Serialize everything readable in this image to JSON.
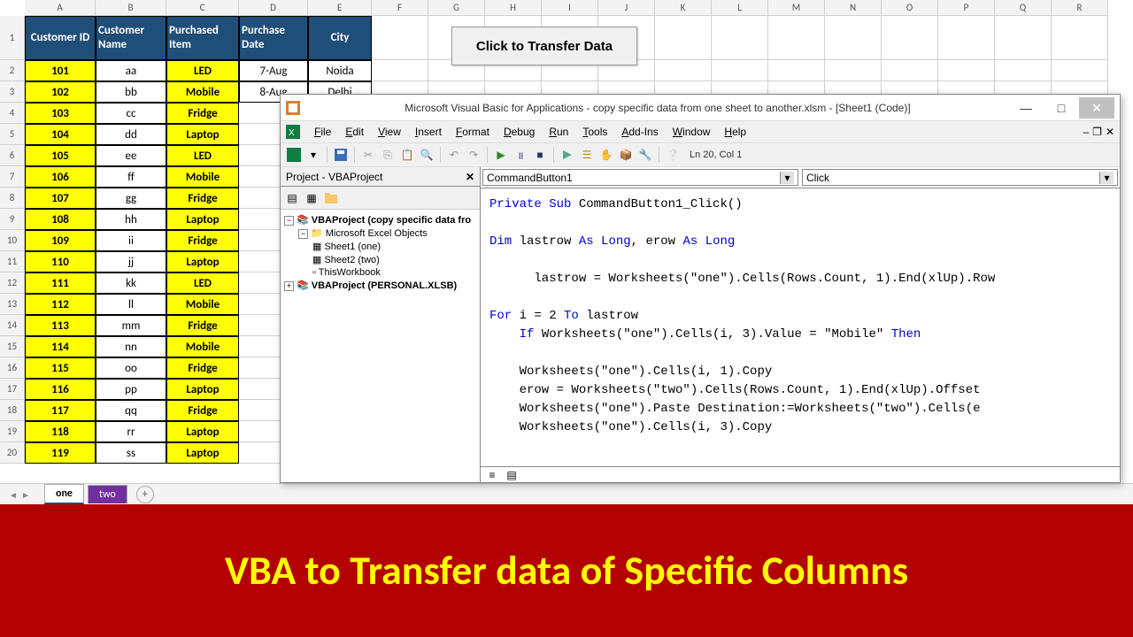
{
  "columns": [
    "A",
    "B",
    "C",
    "D",
    "E",
    "F",
    "G",
    "H",
    "I",
    "J",
    "K",
    "L",
    "M",
    "N",
    "O",
    "P",
    "Q",
    "R"
  ],
  "headers": [
    "Customer ID",
    "Customer Name",
    "Purchased Item",
    "Purchase Date",
    "City"
  ],
  "rows": [
    {
      "id": "101",
      "name": "aa",
      "item": "LED",
      "date": "7-Aug",
      "city": "Noida"
    },
    {
      "id": "102",
      "name": "bb",
      "item": "Mobile",
      "date": "8-Aug",
      "city": "Delhi"
    },
    {
      "id": "103",
      "name": "cc",
      "item": "Fridge",
      "date": "",
      "city": ""
    },
    {
      "id": "104",
      "name": "dd",
      "item": "Laptop",
      "date": "",
      "city": ""
    },
    {
      "id": "105",
      "name": "ee",
      "item": "LED",
      "date": "",
      "city": ""
    },
    {
      "id": "106",
      "name": "ff",
      "item": "Mobile",
      "date": "",
      "city": ""
    },
    {
      "id": "107",
      "name": "gg",
      "item": "Fridge",
      "date": "",
      "city": ""
    },
    {
      "id": "108",
      "name": "hh",
      "item": "Laptop",
      "date": "",
      "city": ""
    },
    {
      "id": "109",
      "name": "ii",
      "item": "Fridge",
      "date": "",
      "city": ""
    },
    {
      "id": "110",
      "name": "jj",
      "item": "Laptop",
      "date": "",
      "city": ""
    },
    {
      "id": "111",
      "name": "kk",
      "item": "LED",
      "date": "",
      "city": ""
    },
    {
      "id": "112",
      "name": "ll",
      "item": "Mobile",
      "date": "",
      "city": ""
    },
    {
      "id": "113",
      "name": "mm",
      "item": "Fridge",
      "date": "",
      "city": ""
    },
    {
      "id": "114",
      "name": "nn",
      "item": "Mobile",
      "date": "",
      "city": ""
    },
    {
      "id": "115",
      "name": "oo",
      "item": "Fridge",
      "date": "",
      "city": ""
    },
    {
      "id": "116",
      "name": "pp",
      "item": "Laptop",
      "date": "",
      "city": ""
    },
    {
      "id": "117",
      "name": "qq",
      "item": "Fridge",
      "date": "",
      "city": ""
    },
    {
      "id": "118",
      "name": "rr",
      "item": "Laptop",
      "date": "",
      "city": ""
    },
    {
      "id": "119",
      "name": "ss",
      "item": "Laptop",
      "date": "",
      "city": ""
    }
  ],
  "transfer_button": "Click to Transfer Data",
  "sheets": {
    "one": "one",
    "two": "two"
  },
  "vba": {
    "title": "Microsoft Visual Basic for Applications - copy specific data from one sheet to another.xlsm - [Sheet1 (Code)]",
    "menus": [
      "File",
      "Edit",
      "View",
      "Insert",
      "Format",
      "Debug",
      "Run",
      "Tools",
      "Add-Ins",
      "Window",
      "Help"
    ],
    "cursor": "Ln 20, Col 1",
    "project_title": "Project - VBAProject",
    "tree": {
      "root": "VBAProject (copy specific data fro",
      "folder": "Microsoft Excel Objects",
      "sheet1": "Sheet1 (one)",
      "sheet2": "Sheet2 (two)",
      "wb": "ThisWorkbook",
      "personal": "VBAProject (PERSONAL.XLSB)"
    },
    "dd_left": "CommandButton1",
    "dd_right": "Click",
    "code": {
      "l1a": "Private Sub",
      "l1b": " CommandButton1_Click()",
      "l2a": "Dim",
      "l2b": " lastrow ",
      "l2c": "As Long",
      "l2d": ", erow ",
      "l2e": "As Long",
      "l3": "      lastrow = Worksheets(\"one\").Cells(Rows.Count, 1).End(xlUp).Row",
      "l4a": "For",
      "l4b": " i = 2 ",
      "l4c": "To",
      "l4d": " lastrow",
      "l5a": "    If",
      "l5b": " Worksheets(\"one\").Cells(i, 3).Value = \"Mobile\" ",
      "l5c": "Then",
      "l6": "    Worksheets(\"one\").Cells(i, 1).Copy",
      "l7": "    erow = Worksheets(\"two\").Cells(Rows.Count, 1).End(xlUp).Offset",
      "l8": "    Worksheets(\"one\").Paste Destination:=Worksheets(\"two\").Cells(e",
      "l9": "    Worksheets(\"one\").Cells(i, 3).Copy"
    }
  },
  "banner": "VBA to Transfer data of Specific Columns"
}
